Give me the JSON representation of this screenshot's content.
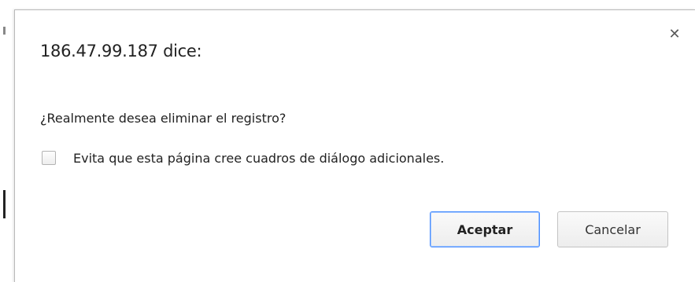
{
  "dialog": {
    "title": "186.47.99.187 dice:",
    "close_icon": "close-icon",
    "message": "¿Realmente desea eliminar el registro?",
    "suppress_label": "Evita que esta página cree cuadros de diálogo adicionales.",
    "suppress_checked": false,
    "accept_label": "Aceptar",
    "cancel_label": "Cancelar"
  },
  "colors": {
    "default_button_border": "#4d90fe",
    "text": "#222222"
  }
}
